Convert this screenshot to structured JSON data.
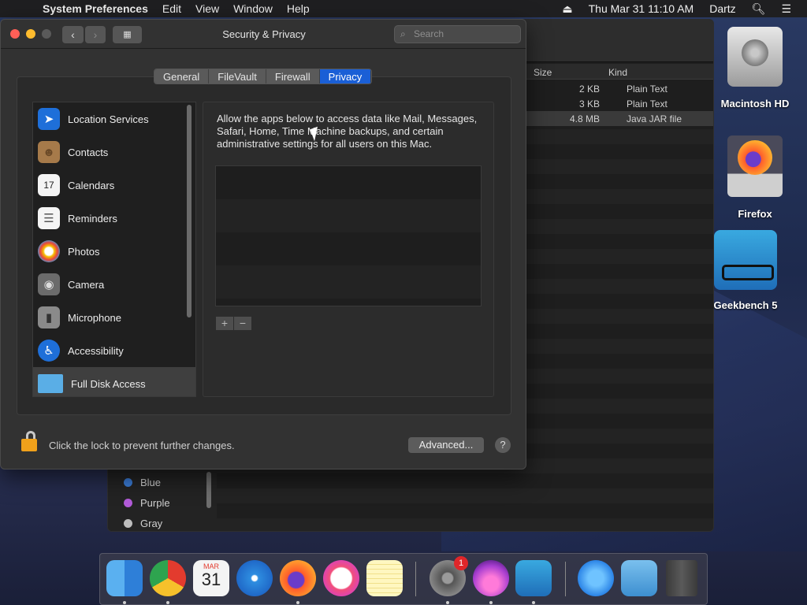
{
  "menubar": {
    "app_name": "System Preferences",
    "menus": [
      "Edit",
      "View",
      "Window",
      "Help"
    ],
    "datetime": "Thu Mar 31  11:10 AM",
    "user": "Dartz"
  },
  "finder": {
    "columns": {
      "size": "Size",
      "kind": "Kind"
    },
    "rows": [
      {
        "size": "2 KB",
        "kind": "Plain Text"
      },
      {
        "size": "3 KB",
        "kind": "Plain Text"
      },
      {
        "size": "4.8 MB",
        "kind": "Java JAR file"
      }
    ],
    "tags": [
      {
        "name": "Blue",
        "color": "#3a7bd5"
      },
      {
        "name": "Purple",
        "color": "#b25bd8"
      },
      {
        "name": "Gray",
        "color": "#bdbdbd"
      }
    ]
  },
  "desktop": {
    "icons": [
      "Macintosh HD",
      "Firefox",
      "Geekbench 5"
    ]
  },
  "window": {
    "title": "Security & Privacy",
    "search_placeholder": "Search",
    "tabs": [
      "General",
      "FileVault",
      "Firewall",
      "Privacy"
    ],
    "active_tab": "Privacy",
    "privacy_items": [
      {
        "label": "Location Services",
        "icon": "location-icon",
        "color": "#1e6fd9"
      },
      {
        "label": "Contacts",
        "icon": "contacts-icon",
        "color": "#a67a4a"
      },
      {
        "label": "Calendars",
        "icon": "calendar-icon",
        "color": "#f4f4f4"
      },
      {
        "label": "Reminders",
        "icon": "reminders-icon",
        "color": "#f4f4f4"
      },
      {
        "label": "Photos",
        "icon": "photos-icon",
        "color": "#ffffff"
      },
      {
        "label": "Camera",
        "icon": "camera-icon",
        "color": "#6b6b6b"
      },
      {
        "label": "Microphone",
        "icon": "microphone-icon",
        "color": "#8a8a8a"
      },
      {
        "label": "Accessibility",
        "icon": "accessibility-icon",
        "color": "#1e6fd9"
      },
      {
        "label": "Full Disk Access",
        "icon": "folder-icon",
        "color": "#5aaee6"
      }
    ],
    "selected_item": "Full Disk Access",
    "description": "Allow the apps below to access data like Mail, Messages, Safari, Home, Time Machine backups, and certain administrative settings for all users on this Mac.",
    "lock_text": "Click the lock to prevent further changes.",
    "advanced_label": "Advanced...",
    "help_label": "?",
    "add_label": "+",
    "remove_label": "−"
  },
  "dock": {
    "calendar_month": "MAR",
    "calendar_day": "31",
    "system_prefs_badge": "1"
  }
}
